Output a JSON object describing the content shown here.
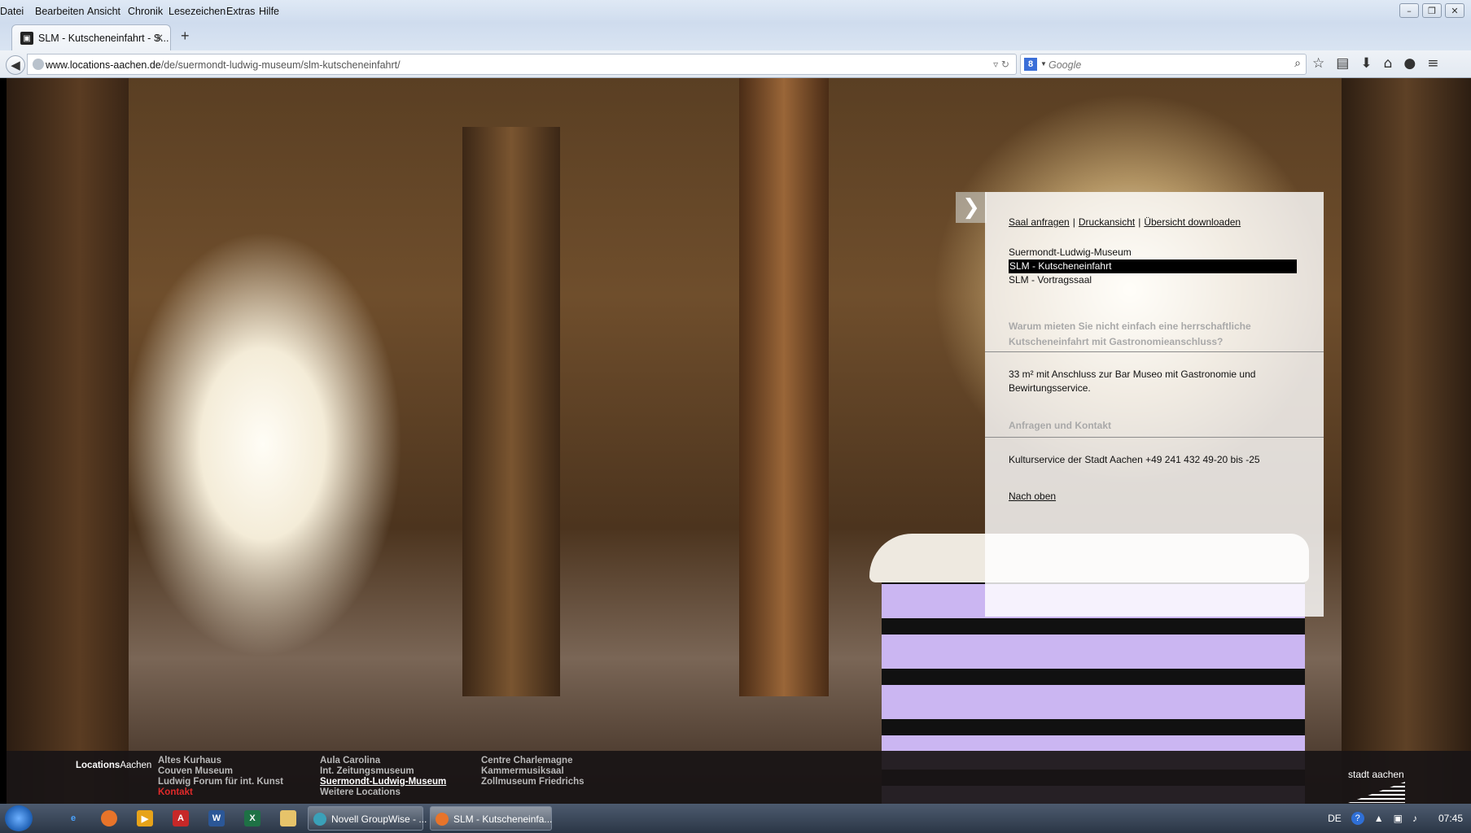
{
  "menubar": {
    "items": [
      "Datei",
      "Bearbeiten",
      "Ansicht",
      "Chronik",
      "Lesezeichen",
      "Extras",
      "Hilfe"
    ]
  },
  "tab": {
    "title": "SLM - Kutscheneinfahrt - S..."
  },
  "navbar": {
    "url_domain": "www.locations-aachen.de",
    "url_path": "/de/suermondt-ludwig-museum/slm-kutscheneinfahrt/",
    "search_placeholder": "Google"
  },
  "panel": {
    "links": [
      "Saal anfragen",
      "Druckansicht",
      "Übersicht downloaden"
    ],
    "link_separator": "|",
    "subnav": [
      "Suermondt-Ludwig-Museum",
      "SLM - Kutscheneinfahrt",
      "SLM - Vortragssaal"
    ],
    "active_subnav": "SLM - Kutscheneinfahrt",
    "teaser": "Warum mieten Sie nicht einfach eine herrschaftliche Kutscheneinfahrt mit Gastronomieanschluss?",
    "description": "33 m² mit Anschluss zur Bar Museo mit Gastronomie und Bewirtungsservice.",
    "contact_heading": "Anfragen und Kontakt",
    "contact_text": "Kulturservice der Stadt Aachen +49 241 432 49-20 bis -25",
    "back_to_top": "Nach oben"
  },
  "footer": {
    "brand_bold": "Locations",
    "brand_regular": "Aachen",
    "col1": [
      "Altes Kurhaus",
      "Couven Museum",
      "Ludwig Forum für int. Kunst",
      "Kontakt"
    ],
    "col2": [
      "Aula Carolina",
      "Int. Zeitungsmuseum",
      "Suermondt-Ludwig-Museum",
      "Weitere Locations"
    ],
    "col3": [
      "Centre Charlemagne",
      "Kammermusiksaal",
      "Zollmuseum Friedrichs"
    ],
    "logo_text": "stadt aachen"
  },
  "taskbar": {
    "tasks": [
      "Novell GroupWise - ...",
      "SLM - Kutscheneinfa..."
    ],
    "lang": "DE",
    "clock": "07:45"
  },
  "colors": {
    "accent_red": "#e02a2a",
    "active_bg": "#000000"
  }
}
